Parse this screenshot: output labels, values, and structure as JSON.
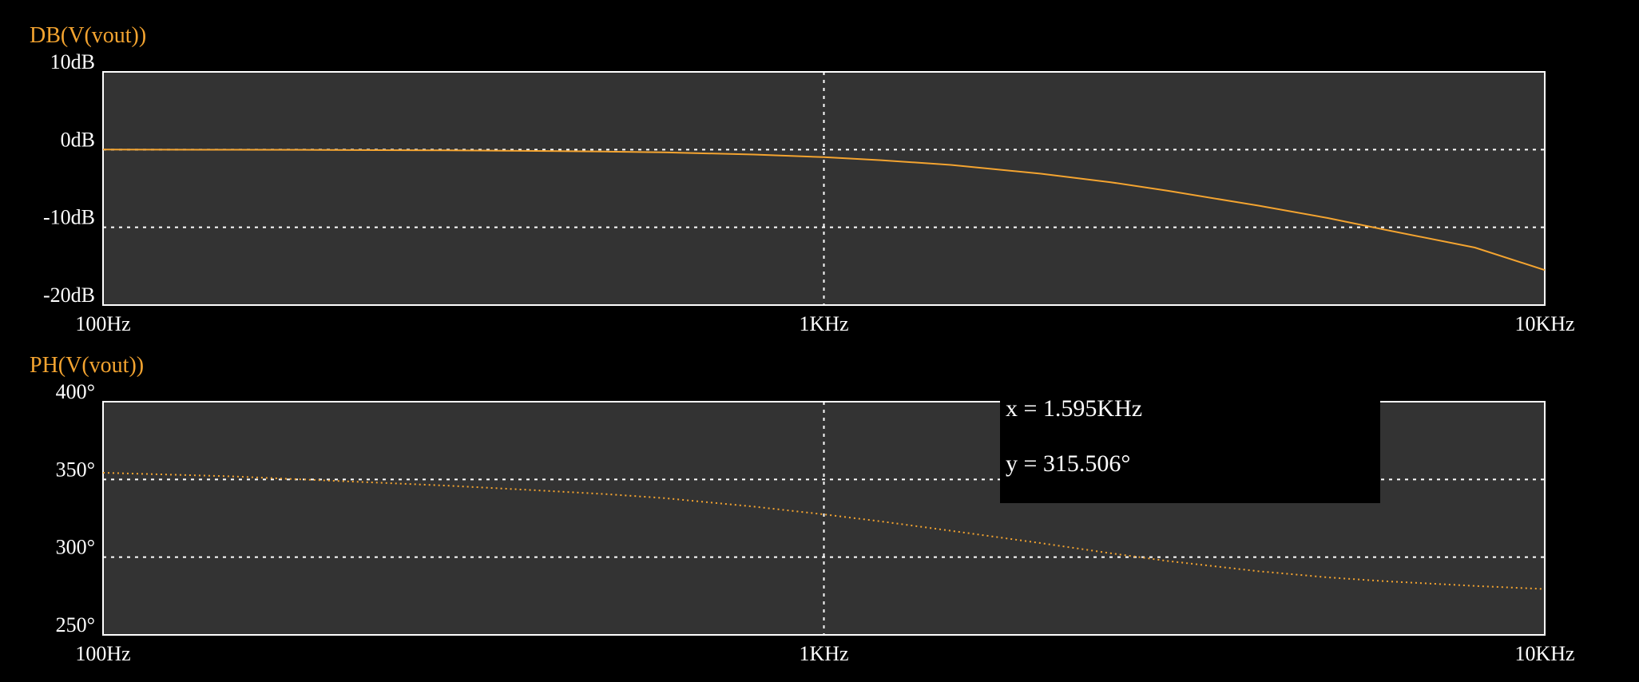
{
  "colors": {
    "background": "#000000",
    "plot_area": "#333333",
    "frame": "#ffffff",
    "grid": "#ffffff",
    "trace": "#f4a430",
    "title": "#f4a430",
    "tick_label": "#ffffff",
    "cursor_box": "#000000",
    "cursor_text": "#ffffff"
  },
  "cursor": {
    "x_text": "x = 1.595KHz",
    "y_text": "y = 315.506°"
  },
  "chart_data": [
    {
      "type": "line",
      "title": "DB(V(vout))",
      "xlabel": "",
      "ylabel": "",
      "x_scale": "log",
      "xlim": [
        100,
        10000
      ],
      "ylim": [
        -20,
        10
      ],
      "grid": true,
      "line_style": "solid",
      "x_ticks": [
        {
          "value": 100,
          "label": "100Hz"
        },
        {
          "value": 1000,
          "label": "1KHz"
        },
        {
          "value": 10000,
          "label": "10KHz"
        }
      ],
      "y_ticks": [
        {
          "value": 10,
          "label": "10dB"
        },
        {
          "value": 0,
          "label": "0dB"
        },
        {
          "value": -10,
          "label": "-10dB"
        },
        {
          "value": -20,
          "label": "-20dB"
        }
      ],
      "series": [
        {
          "x": [
            100,
            150,
            200,
            300,
            400,
            500,
            600,
            800,
            1000,
            1200,
            1500,
            2000,
            2500,
            3000,
            4000,
            5000,
            6000,
            8000,
            10000
          ],
          "y": [
            0.0,
            -0.02,
            -0.04,
            -0.1,
            -0.17,
            -0.25,
            -0.36,
            -0.63,
            -0.97,
            -1.36,
            -1.97,
            -3.1,
            -4.2,
            -5.3,
            -7.2,
            -8.8,
            -10.3,
            -12.6,
            -15.5
          ]
        }
      ]
    },
    {
      "type": "line",
      "title": "PH(V(vout))",
      "xlabel": "",
      "ylabel": "",
      "x_scale": "log",
      "xlim": [
        100,
        10000
      ],
      "ylim": [
        250,
        400
      ],
      "grid": true,
      "line_style": "dotted",
      "x_ticks": [
        {
          "value": 100,
          "label": "100Hz"
        },
        {
          "value": 1000,
          "label": "1KHz"
        },
        {
          "value": 10000,
          "label": "10KHz"
        }
      ],
      "y_ticks": [
        {
          "value": 400,
          "label": "400°"
        },
        {
          "value": 350,
          "label": "350°"
        },
        {
          "value": 300,
          "label": "300°"
        },
        {
          "value": 250,
          "label": "250°"
        }
      ],
      "series": [
        {
          "x": [
            100,
            150,
            200,
            300,
            400,
            500,
            600,
            800,
            1000,
            1200,
            1500,
            2000,
            2500,
            3000,
            4000,
            5000,
            6000,
            8000,
            10000
          ],
          "y": [
            354.3,
            352,
            349.5,
            346,
            343,
            340.5,
            338,
            332.5,
            327.5,
            323,
            317,
            309,
            302.5,
            297.5,
            291,
            287,
            284.5,
            281.5,
            279.5
          ]
        }
      ]
    }
  ]
}
